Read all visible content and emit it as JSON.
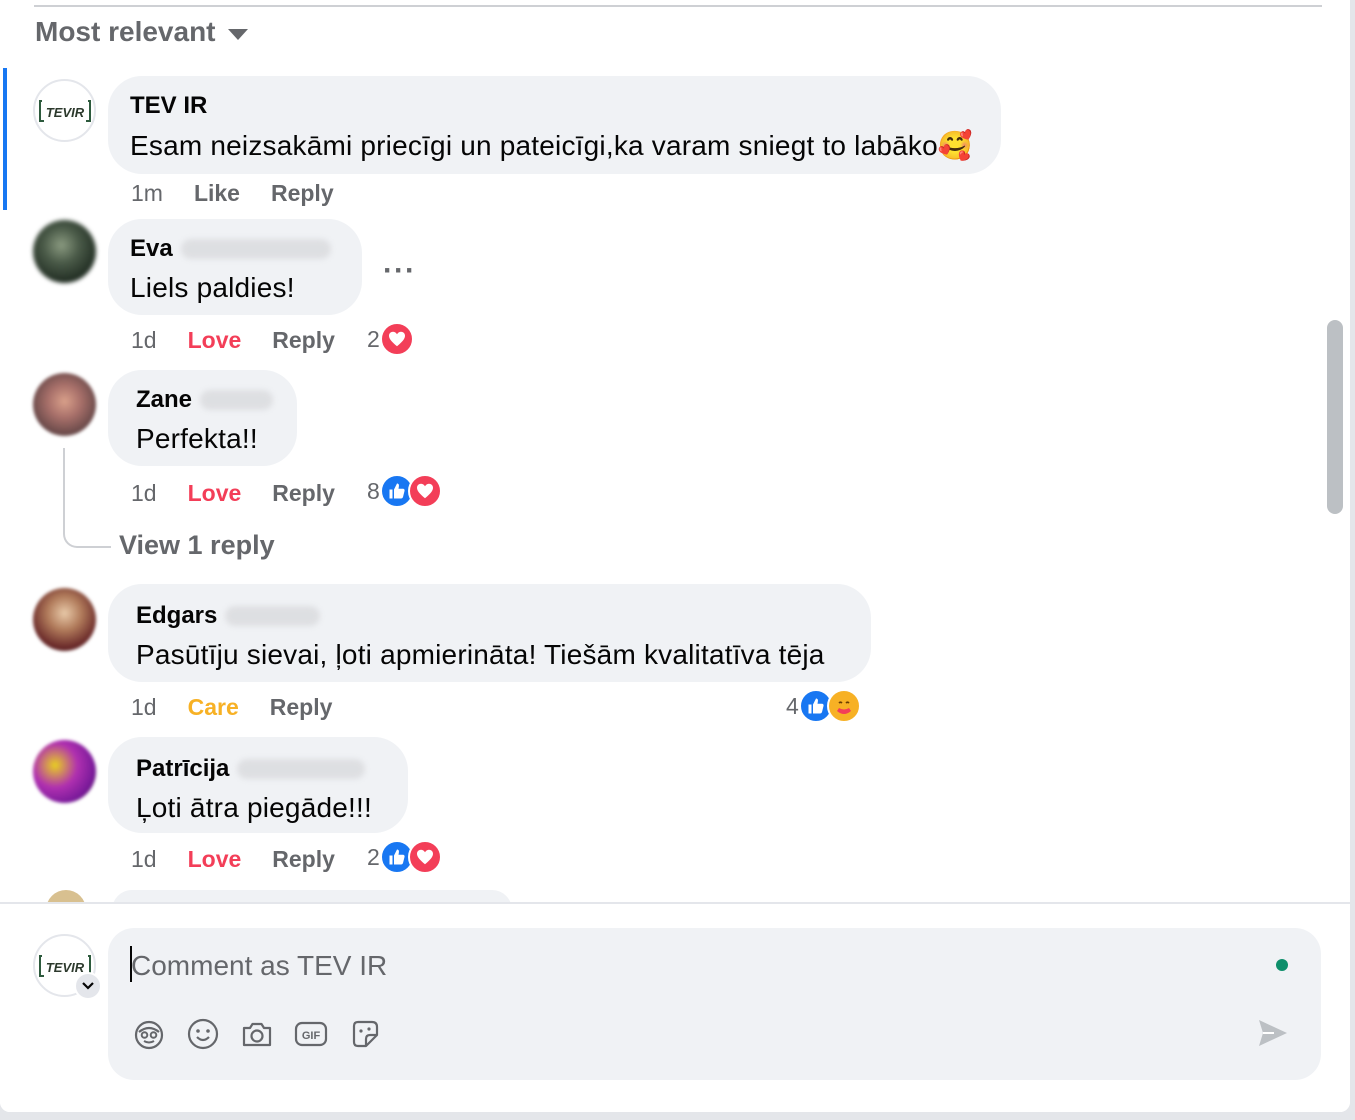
{
  "sort": {
    "label": "Most relevant"
  },
  "comments": [
    {
      "author": "TEV IR",
      "text": "Esam neizsakāmi priecīgi un pateicīgi,ka varam sniegt to labāko🥰",
      "time": "1m",
      "like": "Like",
      "reply": "Reply",
      "avatar_icon": "tev-ir-logo-icon"
    },
    {
      "author": "Eva",
      "text": "Liels paldies!",
      "time": "1d",
      "like": "Love",
      "reply": "Reply",
      "reaction_count": "2",
      "reactions": [
        "heart"
      ],
      "more": "···"
    },
    {
      "author": "Zane",
      "text": "Perfekta!!",
      "time": "1d",
      "like": "Love",
      "reply": "Reply",
      "reaction_count": "8",
      "reactions": [
        "like",
        "heart"
      ],
      "view_replies": "View 1 reply"
    },
    {
      "author": "Edgars",
      "text": "Pasūtīju sievai, ļoti apmierināta! Tiešām kvalitatīva tēja",
      "time": "1d",
      "like": "Care",
      "reply": "Reply",
      "reaction_count": "4",
      "reactions": [
        "like",
        "care"
      ]
    },
    {
      "author": "Patrīcija",
      "text": "Ļoti ātra piegāde!!!",
      "time": "1d",
      "like": "Love",
      "reply": "Reply",
      "reaction_count": "2",
      "reactions": [
        "like",
        "heart"
      ]
    }
  ],
  "composer": {
    "placeholder": "Comment as TEV IR",
    "tools": [
      "avatar-sticker-icon",
      "emoji-icon",
      "camera-icon",
      "gif-icon",
      "sticker-icon"
    ],
    "send_icon": "send-icon",
    "status_color": "#0e8f6b"
  },
  "colors": {
    "accent": "#1877f2",
    "love": "#f33e58",
    "care": "#f7b125",
    "secondary_text": "#65676b",
    "bubble": "#f0f2f5"
  }
}
